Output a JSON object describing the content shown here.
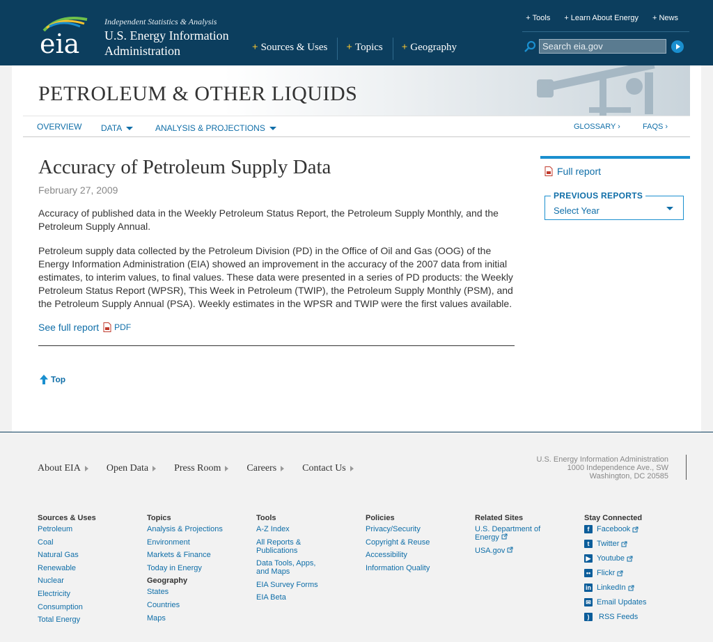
{
  "header": {
    "tagline": "Independent Statistics & Analysis",
    "org_line1": "U.S. Energy Information",
    "org_line2": "Administration",
    "logo_text": "eia",
    "main_nav": [
      "Sources & Uses",
      "Topics",
      "Geography"
    ],
    "util_nav": [
      "Tools",
      "Learn About Energy",
      "News"
    ],
    "search_placeholder": "Search eia.gov"
  },
  "banner": {
    "title": "PETROLEUM & OTHER LIQUIDS"
  },
  "subnav": {
    "overview": "OVERVIEW",
    "data": "DATA",
    "analysis": "ANALYSIS & PROJECTIONS",
    "glossary": "GLOSSARY ›",
    "faqs": "FAQS ›"
  },
  "article": {
    "title": "Accuracy of Petroleum Supply Data",
    "date": "February 27, 2009",
    "para1": "Accuracy of published data in the Weekly Petroleum Status Report, the Petroleum Supply Monthly, and the Petroleum Supply Annual.",
    "para2": "Petroleum supply data collected by the Petroleum Division (PD) in the Office of Oil and Gas (OOG) of the Energy Information Administration (EIA) showed an improvement in the accuracy of the 2007 data from initial estimates, to interim values, to final values. These data were presented in a series of PD products: the Weekly Petroleum Status Report (WPSR), This Week in Petroleum (TWIP), the Petroleum Supply Monthly (PSM), and the Petroleum Supply Annual (PSA). Weekly estimates in the WPSR and TWIP were the first values available.",
    "full_report_link": "See full report",
    "pdf_label": "PDF",
    "top_label": "Top"
  },
  "sidebar": {
    "full_report": "Full report",
    "prev_reports_label": "PREVIOUS REPORTS",
    "select_value": "Select Year"
  },
  "footer": {
    "nav": [
      "About EIA",
      "Open Data",
      "Press Room",
      "Careers",
      "Contact Us"
    ],
    "address": [
      "U.S. Energy Information Administration",
      "1000 Independence Ave., SW",
      "Washington, DC 20585"
    ],
    "columns": {
      "sources": {
        "heading": "Sources & Uses",
        "links": [
          "Petroleum",
          "Coal",
          "Natural Gas",
          "Renewable",
          "Nuclear",
          "Electricity",
          "Consumption",
          "Total Energy"
        ]
      },
      "topics": {
        "heading": "Topics",
        "links": [
          "Analysis & Projections",
          "Environment",
          "Markets & Finance",
          "Today in Energy"
        ],
        "sub_heading": "Geography",
        "sub_links": [
          "States",
          "Countries",
          "Maps"
        ]
      },
      "tools": {
        "heading": "Tools",
        "links": [
          "A-Z Index",
          "All Reports & Publications",
          "Data Tools, Apps, and Maps",
          "EIA Survey Forms",
          "EIA Beta"
        ]
      },
      "policies": {
        "heading": "Policies",
        "links": [
          "Privacy/Security",
          "Copyright & Reuse",
          "Accessibility",
          "Information Quality"
        ]
      },
      "related": {
        "heading": "Related Sites",
        "links": [
          "U.S. Department of Energy",
          "USA.gov"
        ]
      },
      "social": {
        "heading": "Stay Connected",
        "links": [
          "Facebook",
          "Twitter",
          "Youtube",
          "Flickr",
          "LinkedIn",
          "Email Updates",
          "RSS Feeds"
        ]
      }
    }
  },
  "colors": {
    "header_bg": "#0c3e5e",
    "link": "#0f6ea8",
    "accent": "#1a8fcf",
    "plus": "#f5c330"
  }
}
